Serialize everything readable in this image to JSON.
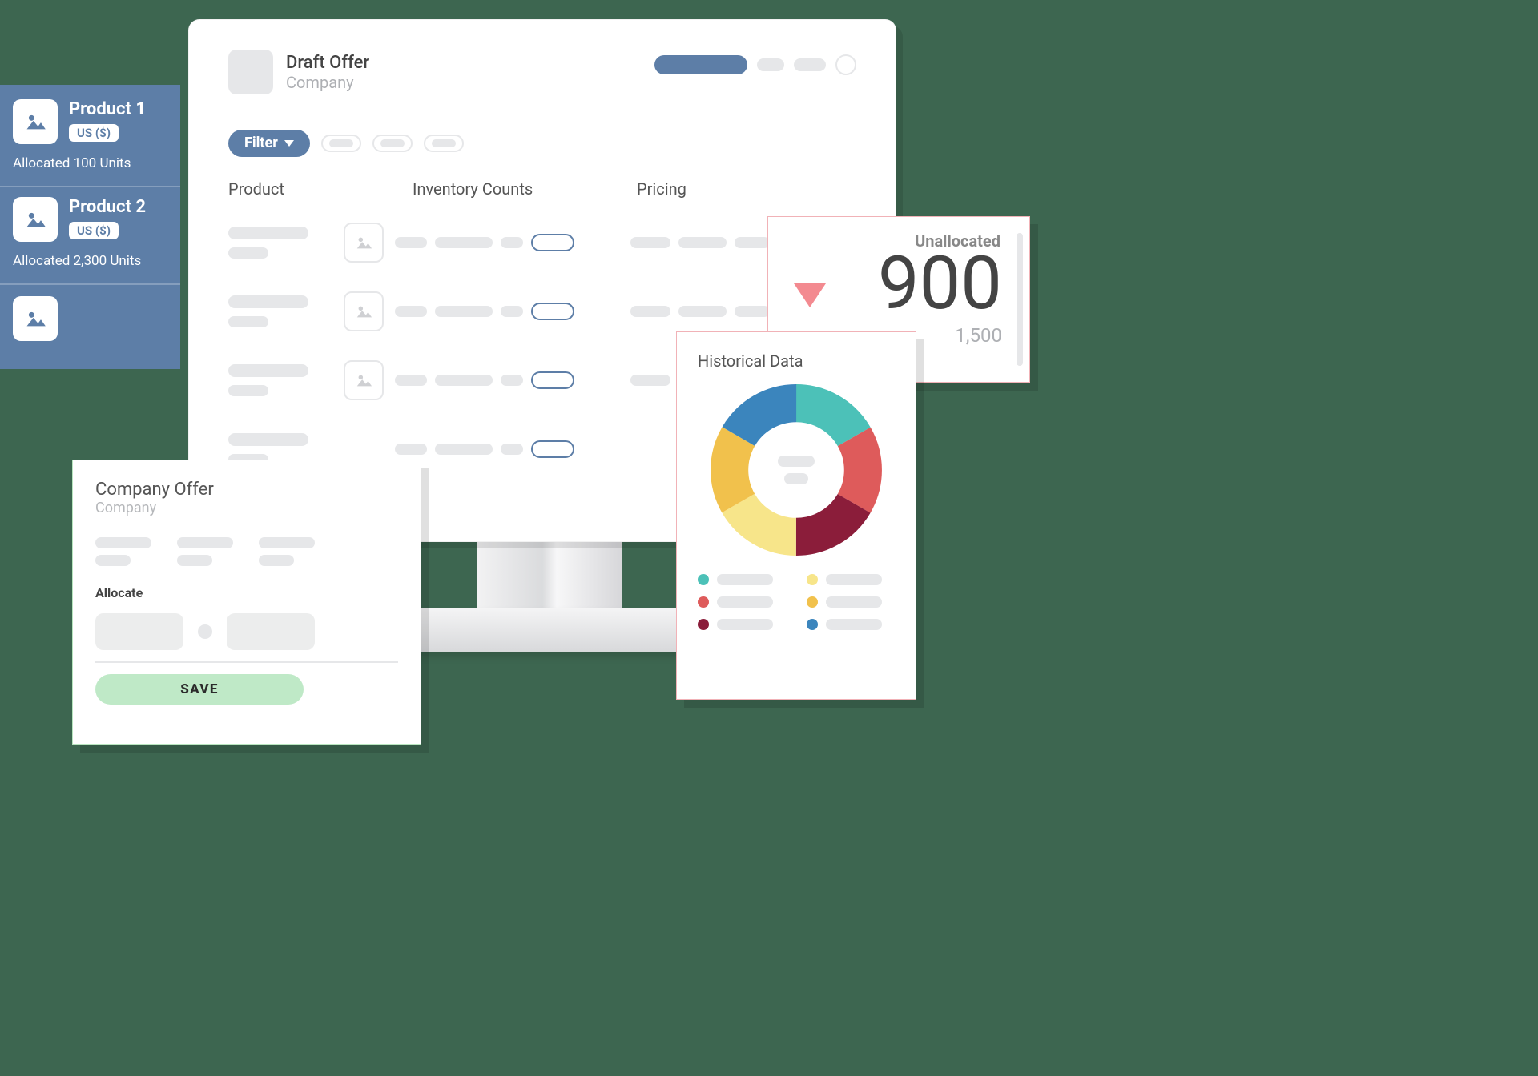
{
  "monitor": {
    "title": "Draft Offer",
    "subtitle": "Company",
    "filter_label": "Filter",
    "columns": {
      "product": "Product",
      "inventory": "Inventory Counts",
      "pricing": "Pricing"
    }
  },
  "product_panel": {
    "items": [
      {
        "name": "Product 1",
        "currency": "US ($)",
        "allocation": "Allocated 100 Units"
      },
      {
        "name": "Product 2",
        "currency": "US ($)",
        "allocation": "Allocated 2,300 Units"
      }
    ]
  },
  "offer_card": {
    "title": "Company Offer",
    "subtitle": "Company",
    "allocate_label": "Allocate",
    "save_label": "SAVE"
  },
  "metric": {
    "label": "Unallocated",
    "value": "900",
    "subvalue": "1,500"
  },
  "historical": {
    "title": "Historical Data"
  },
  "colors": {
    "primary": "#5d7ea7"
  },
  "chart_data": {
    "type": "pie",
    "title": "Historical Data",
    "series": [
      {
        "name": "teal",
        "value": 16.7,
        "color": "#4cc1b8"
      },
      {
        "name": "red",
        "value": 16.7,
        "color": "#de5b5b"
      },
      {
        "name": "maroon",
        "value": 16.7,
        "color": "#8b1d3a"
      },
      {
        "name": "pale",
        "value": 16.7,
        "color": "#f7e58a"
      },
      {
        "name": "gold",
        "value": 16.7,
        "color": "#f1c14c"
      },
      {
        "name": "blue",
        "value": 16.7,
        "color": "#3b85bd"
      }
    ]
  }
}
